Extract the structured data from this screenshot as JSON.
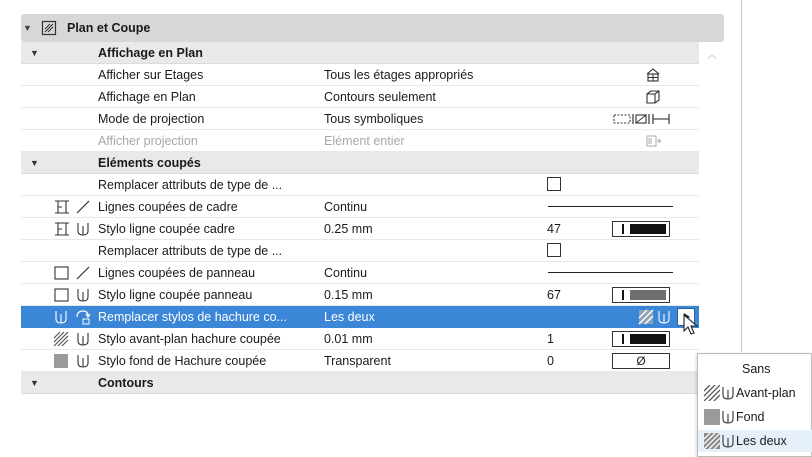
{
  "section": {
    "title": "Plan et Coupe",
    "arrow_icon": "triangle-down-icon",
    "icon": "plan-section-icon"
  },
  "groups": {
    "affichage": {
      "title": "Affichage en Plan"
    },
    "elements": {
      "title": "Eléments coupés"
    },
    "contours": {
      "title": "Contours"
    }
  },
  "rows": [
    {
      "label": "Afficher sur Etages",
      "value": "Tous les étages appropriés",
      "icon": "floor-building-icon"
    },
    {
      "label": "Affichage en Plan",
      "value": "Contours seulement",
      "icon": "box-outline-icon"
    },
    {
      "label": "Mode de projection",
      "value": "Tous symboliques",
      "icon": "projection-symbolic-icon"
    },
    {
      "label": "Afficher projection",
      "value": "Elément entier",
      "icon": "projection-entire-icon",
      "disabled": true
    },
    {
      "label": "Remplacer attributs de type de ...",
      "checked": false
    },
    {
      "label": "Lignes coupées de cadre",
      "value": "Continu",
      "left_icons": [
        "frame-profile-icon",
        "line-type-icon"
      ]
    },
    {
      "label": "Stylo ligne coupée cadre",
      "value": "0.25 mm",
      "number": "47",
      "pen_color": "#111111",
      "left_icons": [
        "frame-profile-icon",
        "pen-icon"
      ]
    },
    {
      "label": "Remplacer attributs de type de ...",
      "checked": false
    },
    {
      "label": "Lignes coupées de panneau",
      "value": "Continu",
      "left_icons": [
        "panel-square-icon",
        "line-type-icon"
      ]
    },
    {
      "label": "Stylo ligne coupée panneau",
      "value": "0.15 mm",
      "number": "67",
      "pen_color": "#6f6f6f",
      "left_icons": [
        "panel-square-icon",
        "pen-icon"
      ]
    },
    {
      "label": "Remplacer stylos de hachure co...",
      "value": "Les deux",
      "selected": true,
      "left_icons": [
        "pen-icon",
        "override-pen-icon"
      ],
      "right_icons": [
        "hatch-icon",
        "pen-icon"
      ],
      "button_icon": "popup-arrow-icon"
    },
    {
      "label": "Stylo avant-plan hachure coupée",
      "value": "0.01 mm",
      "number": "1",
      "pen_color": "#111111",
      "left_icons": [
        "hatch-icon",
        "pen-icon"
      ]
    },
    {
      "label": "Stylo fond de Hachure coupée",
      "value": "Transparent",
      "number": "0",
      "fill_symbol": "Ø",
      "left_icons": [
        "solid-fill-icon",
        "pen-icon"
      ]
    }
  ],
  "popup": {
    "items": [
      {
        "label": "Sans",
        "icon": ""
      },
      {
        "label": "Avant-plan",
        "icon": "hatch-icon"
      },
      {
        "label": "Fond",
        "icon": "solid-fill-icon"
      },
      {
        "label": "Les deux",
        "icon": "hatch-icon",
        "highlighted": true
      }
    ]
  },
  "colors": {
    "selection": "#3b86d6",
    "header": "#d7d7d7",
    "group": "#e9e9e9"
  }
}
